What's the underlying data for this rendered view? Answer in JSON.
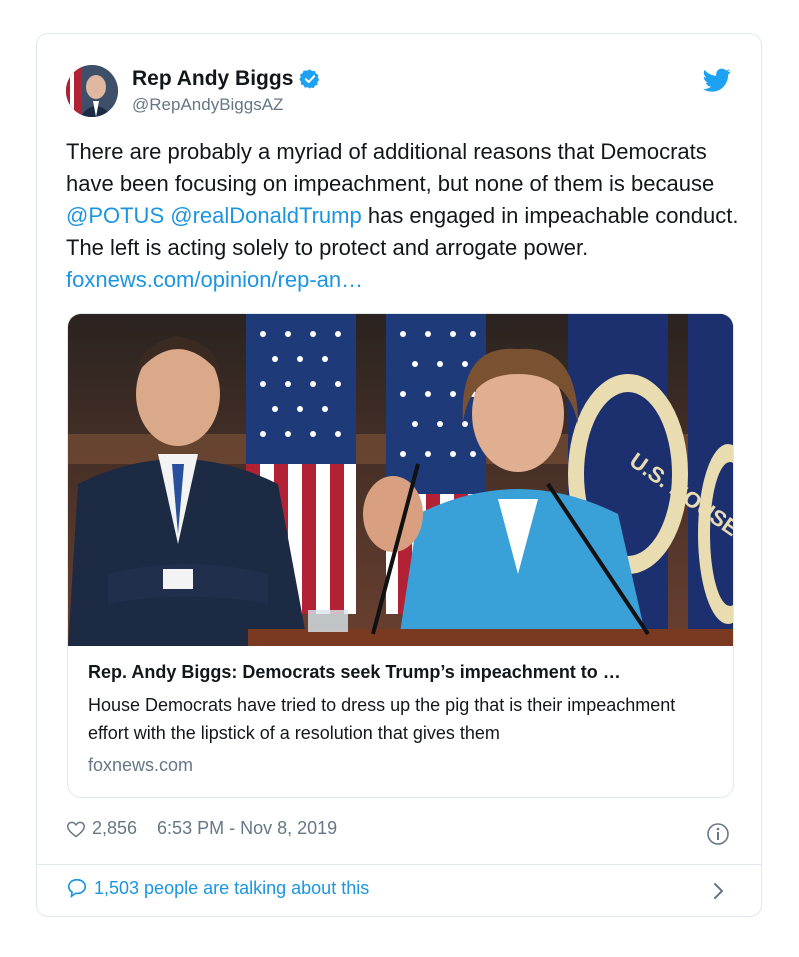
{
  "author": {
    "display_name": "Rep Andy Biggs",
    "handle": "@RepAndyBiggsAZ",
    "verified": true
  },
  "tweet": {
    "text_1": "There are probably a myriad of additional reasons that Democrats have been focusing on impeachment, but none of them is because ",
    "mention_1": "@POTUS",
    "space": " ",
    "mention_2": "@realDonaldTrump",
    "text_2": " has engaged in impeachable conduct. The left is acting solely to protect and arrogate power. ",
    "link": "foxnews.com/opinion/rep-an…"
  },
  "link_card": {
    "title": "Rep. Andy Biggs: Democrats seek Trump’s impeachment to …",
    "description": "House Democrats have tried to dress up the pig that is their impeachment effort with the lipstick of a resolution that gives them",
    "domain": "foxnews.com",
    "image_caption_flag_text": "U.S. HOUSE OF"
  },
  "meta": {
    "likes": "2,856",
    "timestamp": "6:53 PM - Nov 8, 2019"
  },
  "footer": {
    "talking": "1,503 people are talking about this"
  },
  "colors": {
    "link": "#1b95e0",
    "secondary_text": "#657786",
    "border": "#e1e8ed"
  },
  "icons": [
    "verified-badge-icon",
    "twitter-bird-icon",
    "heart-icon",
    "info-icon",
    "speech-bubble-icon",
    "chevron-right-icon"
  ]
}
